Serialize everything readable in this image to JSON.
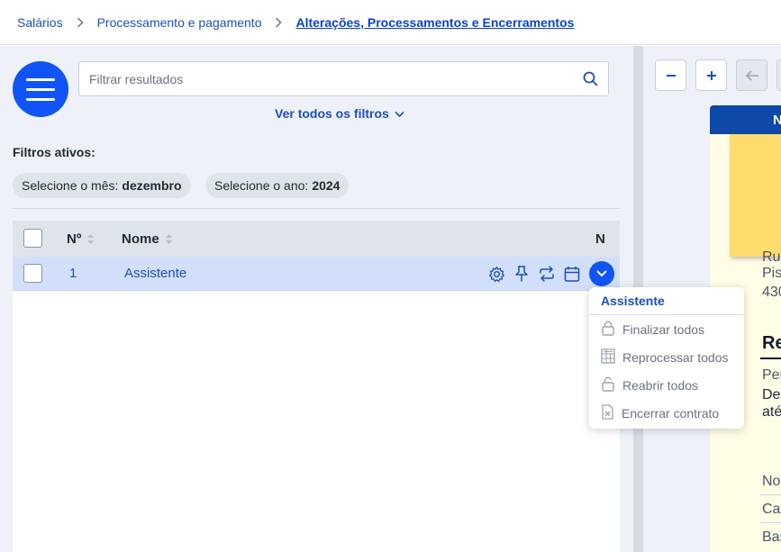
{
  "breadcrumb": {
    "items": [
      "Salários",
      "Processamento e pagamento",
      "Alterações, Processamentos e Encerramentos"
    ]
  },
  "search": {
    "placeholder": "Filtrar resultados"
  },
  "filters": {
    "all_filters_label": "Ver todos os filtros",
    "active_label": "Filtros ativos:",
    "chips": [
      {
        "label": "Selecione o mês:",
        "value": "dezembro"
      },
      {
        "label": "Selecione o ano:",
        "value": "2024"
      }
    ]
  },
  "table": {
    "columns": [
      "Nº",
      "Nome",
      "N"
    ],
    "rows": [
      {
        "number": "1",
        "name": "Assistente"
      }
    ]
  },
  "dropdown": {
    "title": "Assistente",
    "items": [
      {
        "label": "Finalizar todos",
        "icon": "lock-icon"
      },
      {
        "label": "Reprocessar todos",
        "icon": "calculator-icon"
      },
      {
        "label": "Reabrir todos",
        "icon": "unlock-icon"
      },
      {
        "label": "Encerrar contrato",
        "icon": "document-x-icon"
      }
    ]
  },
  "preview": {
    "header_text": "N",
    "lines": [
      "Ru",
      "Pis",
      "430",
      "Re",
      "Per",
      "De",
      "até",
      "No",
      "Cat",
      "Bas"
    ]
  },
  "colors": {
    "accent": "#1054f5",
    "link": "#1e4fb8",
    "selected_row": "#d1dffa",
    "sticky_note": "#fbdc6c",
    "doc_header": "#0d49a8"
  }
}
